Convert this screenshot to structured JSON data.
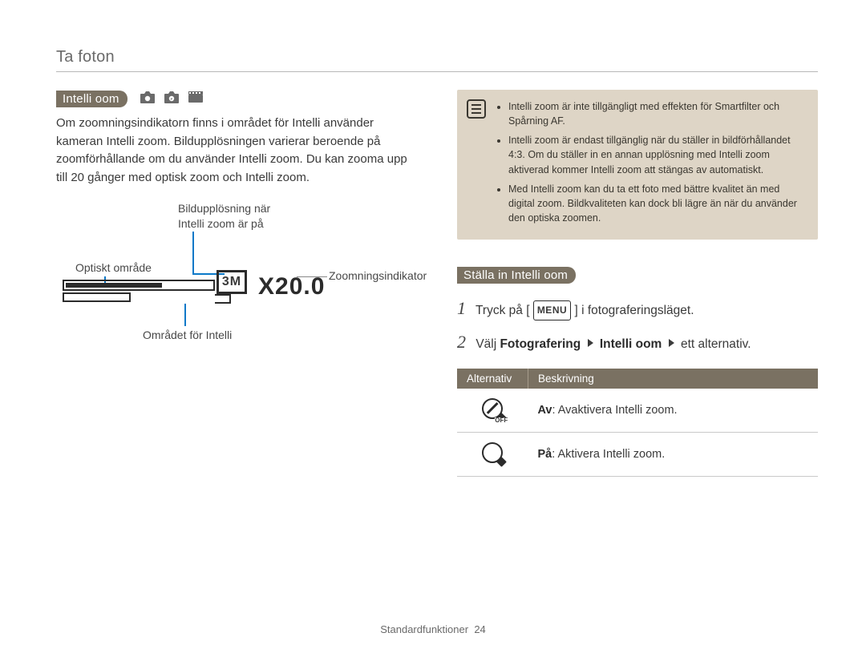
{
  "header": "Ta foton",
  "left": {
    "topic": "Intelli oom",
    "intro": "Om zoomningsindikatorn finns i området för Intelli använder kameran Intelli zoom. Bildupplösningen varierar beroende på zoomförhållande om du använder Intelli zoom. Du kan zooma upp till 20 gånger med optisk zoom och Intelli zoom.",
    "labels": {
      "resolution": "Bildupplösning när",
      "resolution2": "Intelli zoom är på",
      "optical": "Optiskt område",
      "zoomindicator": "Zoomningsindikator",
      "intelliarea": "Området för Intelli",
      "pxbadge": "3M",
      "zoomtext": "X20.0"
    }
  },
  "right": {
    "notes": [
      "Intelli zoom är inte tillgängligt med effekten för Smartfilter och Spårning AF.",
      "Intelli zoom är endast tillgänglig när du ställer in bildförhållandet 4:3. Om du ställer in en annan upplösning med Intelli zoom aktiverad kommer Intelli zoom att stängas av automatiskt.",
      "Med Intelli zoom kan du ta ett foto med bättre kvalitet än med digital zoom. Bildkvaliteten kan dock bli lägre än när du använder den optiska zoomen."
    ],
    "section": "Ställa in Intelli oom",
    "step1_a": "Tryck på [",
    "menu_label": "MENU",
    "step1_b": "] i fotograferingsläget.",
    "step2_a": "Välj ",
    "step2_bold1": "Fotografering",
    "step2_bold2": "Intelli oom",
    "step2_b": " ett alternativ.",
    "table": {
      "head_a": "Alternativ",
      "head_b": "Beskrivning",
      "row1_label": "Av",
      "row1_desc": ": Avaktivera Intelli zoom.",
      "row2_label": "På",
      "row2_desc": ": Aktivera Intelli zoom.",
      "off_tag": "OFF"
    }
  },
  "footer": {
    "label": "Standardfunktioner",
    "page": "24"
  }
}
